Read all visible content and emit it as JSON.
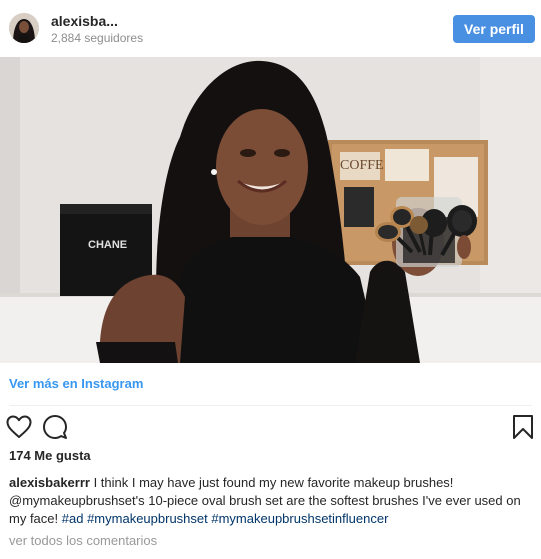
{
  "header": {
    "username": "alexisba...",
    "followers": "2,884 seguidores",
    "view_profile_label": "Ver perfil"
  },
  "media": {
    "box_brand_text": "CHANE",
    "board_text": "COFFE"
  },
  "view_more_label": "Ver más en Instagram",
  "actions": {
    "likes": "174 Me gusta"
  },
  "caption": {
    "username": "alexisbakerrr",
    "text_1": " I think I may have just found my new favorite makeup brushes! ",
    "mention": "@mymakeupbrushset",
    "text_2": "'s 10-piece oval brush set are the softest brushes I've ever used on my face! ",
    "hashtag_1": "#ad",
    "hashtag_2": "#mymakeupbrushset",
    "hashtag_3": "#mymakeupbrushsetinfluencer"
  },
  "view_comments_label": "ver todos los comentarios",
  "colors": {
    "accent": "#4a90e2",
    "link": "#3897f0",
    "hashtag": "#003569",
    "muted": "#8e8e8e"
  }
}
